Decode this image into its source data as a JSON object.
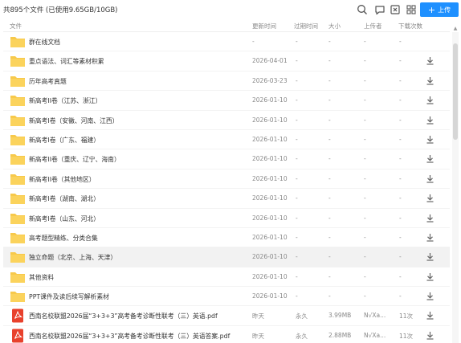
{
  "summary": "共895个文件 (已使用9.65GB/10GB)",
  "toolbar": {
    "search_icon": "search-icon",
    "chat_icon": "chat-icon",
    "close_icon": "close-square-icon",
    "grid_icon": "grid-view-icon",
    "upload_label": "上传"
  },
  "columns": {
    "name": "文件",
    "updated": "更新时间",
    "expires": "过期时间",
    "size": "大小",
    "uploader": "上传者",
    "downloads": "下载次数"
  },
  "files": [
    {
      "type": "folder",
      "name": "群在线文档",
      "updated": "-",
      "expires": "-",
      "size": "-",
      "uploader": "-",
      "downloads": "-",
      "download": false
    },
    {
      "type": "folder",
      "name": "重点语法、词汇等素材积累",
      "updated": "2026-04-01",
      "expires": "-",
      "size": "-",
      "uploader": "-",
      "downloads": "-",
      "download": true
    },
    {
      "type": "folder",
      "name": "历年高考真题",
      "updated": "2026-03-23",
      "expires": "-",
      "size": "-",
      "uploader": "-",
      "downloads": "-",
      "download": true
    },
    {
      "type": "folder",
      "name": "新高考II卷（江苏、浙江）",
      "updated": "2026-01-10",
      "expires": "-",
      "size": "-",
      "uploader": "-",
      "downloads": "-",
      "download": true
    },
    {
      "type": "folder",
      "name": "新高考I卷（安徽、河南、江西）",
      "updated": "2026-01-10",
      "expires": "-",
      "size": "-",
      "uploader": "-",
      "downloads": "-",
      "download": true
    },
    {
      "type": "folder",
      "name": "新高考I卷（广东、福建）",
      "updated": "2026-01-10",
      "expires": "-",
      "size": "-",
      "uploader": "-",
      "downloads": "-",
      "download": true
    },
    {
      "type": "folder",
      "name": "新高考II卷（重庆、辽宁、海南）",
      "updated": "2026-01-10",
      "expires": "-",
      "size": "-",
      "uploader": "-",
      "downloads": "-",
      "download": true
    },
    {
      "type": "folder",
      "name": "新高考II卷（其他地区）",
      "updated": "2026-01-10",
      "expires": "-",
      "size": "-",
      "uploader": "-",
      "downloads": "-",
      "download": true
    },
    {
      "type": "folder",
      "name": "新高考I卷（湖南、湖北）",
      "updated": "2026-01-10",
      "expires": "-",
      "size": "-",
      "uploader": "-",
      "downloads": "-",
      "download": true
    },
    {
      "type": "folder",
      "name": "新高考I卷（山东、河北）",
      "updated": "2026-01-10",
      "expires": "-",
      "size": "-",
      "uploader": "-",
      "downloads": "-",
      "download": true
    },
    {
      "type": "folder",
      "name": "高考题型精练、分类合集",
      "updated": "2026-01-10",
      "expires": "-",
      "size": "-",
      "uploader": "-",
      "downloads": "-",
      "download": true
    },
    {
      "type": "folder",
      "name": "独立命题（北京、上海、天津）",
      "updated": "2026-01-10",
      "expires": "-",
      "size": "-",
      "uploader": "-",
      "downloads": "-",
      "download": true,
      "highlight": true
    },
    {
      "type": "folder",
      "name": "其他资料",
      "updated": "2026-01-10",
      "expires": "-",
      "size": "-",
      "uploader": "-",
      "downloads": "-",
      "download": true
    },
    {
      "type": "folder",
      "name": "PPT课件及读后续写解析素材",
      "updated": "2026-01-10",
      "expires": "-",
      "size": "-",
      "uploader": "-",
      "downloads": "-",
      "download": true
    },
    {
      "type": "pdf",
      "name": "西南名校联盟2026届“3+3+3”高考备考诊断性联考（三）英语.pdf",
      "updated": "昨天",
      "expires": "永久",
      "size": "3.99MB",
      "uploader": "N√Xa...",
      "downloads": "11次",
      "download": true
    },
    {
      "type": "pdf",
      "name": "西南名校联盟2026届“3+3+3”高考备考诊断性联考（三）英语答案.pdf",
      "updated": "昨天",
      "expires": "永久",
      "size": "2.88MB",
      "uploader": "N√Xa...",
      "downloads": "11次",
      "download": true
    }
  ],
  "colors": {
    "accent": "#1e90ff",
    "folder": "#f7c94b",
    "pdf": "#e8412c",
    "row_highlight": "#f2f2f2"
  }
}
